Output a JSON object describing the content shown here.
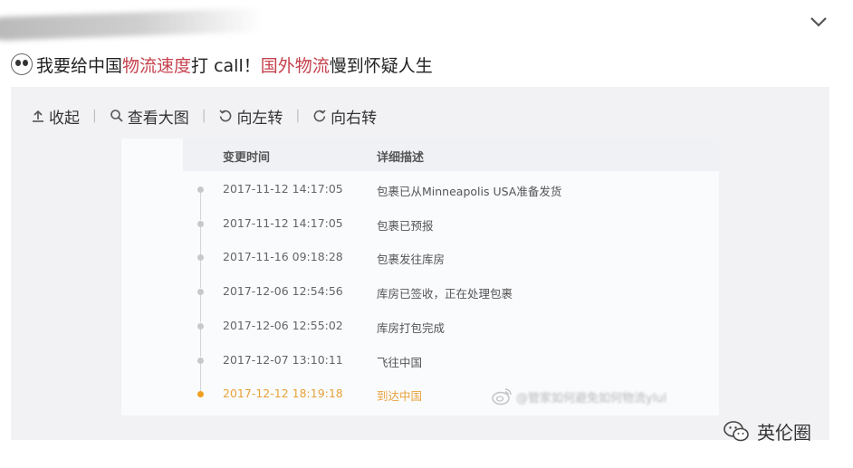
{
  "post": {
    "username_blurred": true,
    "text_parts": [
      {
        "text": "我要给中国",
        "highlight": false
      },
      {
        "text": "物流速度",
        "highlight": true
      },
      {
        "text": "打 call！",
        "highlight": false
      },
      {
        "text": "国外物流",
        "highlight": true
      },
      {
        "text": "慢到怀疑人生",
        "highlight": false
      }
    ]
  },
  "toolbar": {
    "collapse": "收起",
    "view_large": "查看大图",
    "rotate_left": "向左转",
    "rotate_right": "向右转",
    "separator": "|"
  },
  "tracking": {
    "headers": {
      "time": "变更时间",
      "description": "详细描述"
    },
    "rows": [
      {
        "time": "2017-11-12 14:17:05",
        "description": "包裹已从Minneapolis USA准备发货",
        "active": false
      },
      {
        "time": "2017-11-12 14:17:05",
        "description": "包裹已预报",
        "active": false
      },
      {
        "time": "2017-11-16 09:18:28",
        "description": "包裹发往库房",
        "active": false
      },
      {
        "time": "2017-12-06 12:54:56",
        "description": "库房已签收，正在处理包裹",
        "active": false
      },
      {
        "time": "2017-12-06 12:55:02",
        "description": "库房打包完成",
        "active": false
      },
      {
        "time": "2017-12-07 13:10:11",
        "description": "飞往中国",
        "active": false
      },
      {
        "time": "2017-12-12 18:19:18",
        "description": "到达中国",
        "active": true
      }
    ],
    "watermark": "@管家如何避免如何物流ylul"
  },
  "brand": {
    "name": "英伦圈"
  },
  "colors": {
    "highlight": "#c5414c",
    "active": "#f0a020",
    "panel": "#f2f2f5"
  }
}
